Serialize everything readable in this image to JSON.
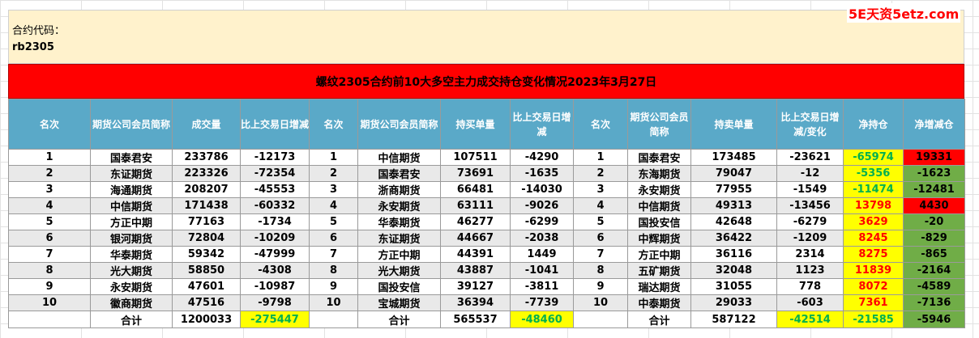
{
  "watermark": "5E天资5etz.com",
  "contract_label": "合约代码：",
  "contract_code": "rb2305",
  "title": "螺纹2305合约前10大多空主力成交持仓变化情况2023年3月27日",
  "headers": [
    "名次",
    "期货公司会员简称",
    "成交量",
    "比上交易日增减",
    "名次",
    "期货公司会员简称",
    "持买单量",
    "比上交易日增减",
    "名次",
    "期货公司会员简称",
    "持卖单量",
    "比上交易日增减/变化",
    "净持仓",
    "净增减仓"
  ],
  "rows": [
    [
      "1",
      "国泰君安",
      "233786",
      "-12173",
      "1",
      "中信期货",
      "107511",
      "-4290",
      "1",
      "国泰君安",
      "173485",
      "-23621",
      "-65974",
      "19331"
    ],
    [
      "2",
      "东证期货",
      "223326",
      "-72354",
      "2",
      "国泰君安",
      "73691",
      "-1635",
      "2",
      "东海期货",
      "79047",
      "-12",
      "-5356",
      "-1623"
    ],
    [
      "3",
      "海通期货",
      "208207",
      "-45553",
      "3",
      "浙商期货",
      "66481",
      "-14030",
      "3",
      "永安期货",
      "77955",
      "-1549",
      "-11474",
      "-12481"
    ],
    [
      "4",
      "中信期货",
      "171438",
      "-60332",
      "4",
      "永安期货",
      "63111",
      "-9026",
      "4",
      "中信期货",
      "49313",
      "-13456",
      "13798",
      "4430"
    ],
    [
      "5",
      "方正中期",
      "77163",
      "-1734",
      "5",
      "华泰期货",
      "46277",
      "-6299",
      "5",
      "国投安信",
      "42648",
      "-6279",
      "3629",
      "-20"
    ],
    [
      "6",
      "银河期货",
      "72804",
      "-10209",
      "6",
      "东证期货",
      "44667",
      "-2038",
      "6",
      "中辉期货",
      "36422",
      "-1209",
      "8245",
      "-829"
    ],
    [
      "7",
      "华泰期货",
      "59342",
      "-47999",
      "7",
      "方正中期",
      "44391",
      "1449",
      "7",
      "方正中期",
      "36116",
      "2314",
      "8275",
      "-865"
    ],
    [
      "8",
      "光大期货",
      "58850",
      "-4308",
      "8",
      "光大期货",
      "43887",
      "-1041",
      "8",
      "五矿期货",
      "32048",
      "1123",
      "11839",
      "-2164"
    ],
    [
      "9",
      "永安期货",
      "47601",
      "-10987",
      "9",
      "国投安信",
      "39127",
      "-3811",
      "9",
      "瑞达期货",
      "31055",
      "778",
      "8072",
      "-4589"
    ],
    [
      "10",
      "徽商期货",
      "47516",
      "-9798",
      "10",
      "宝城期货",
      "36394",
      "-7739",
      "10",
      "中泰期货",
      "29033",
      "-603",
      "7361",
      "-7136"
    ]
  ],
  "total": {
    "label": "合计",
    "volume": "1200033",
    "volume_change": "-275447",
    "long": "565537",
    "long_change": "-48460",
    "short": "587122",
    "short_change": "-42514",
    "net": "-21585",
    "net_change": "-5946"
  },
  "colors": {
    "header_bg": "#5aa9c8",
    "title_bg": "#ff0000",
    "info_bg": "#fff2cc",
    "positive_net_change": "#ff0000",
    "negative_net_change": "#70ad47",
    "highlight": "#ffff00"
  }
}
